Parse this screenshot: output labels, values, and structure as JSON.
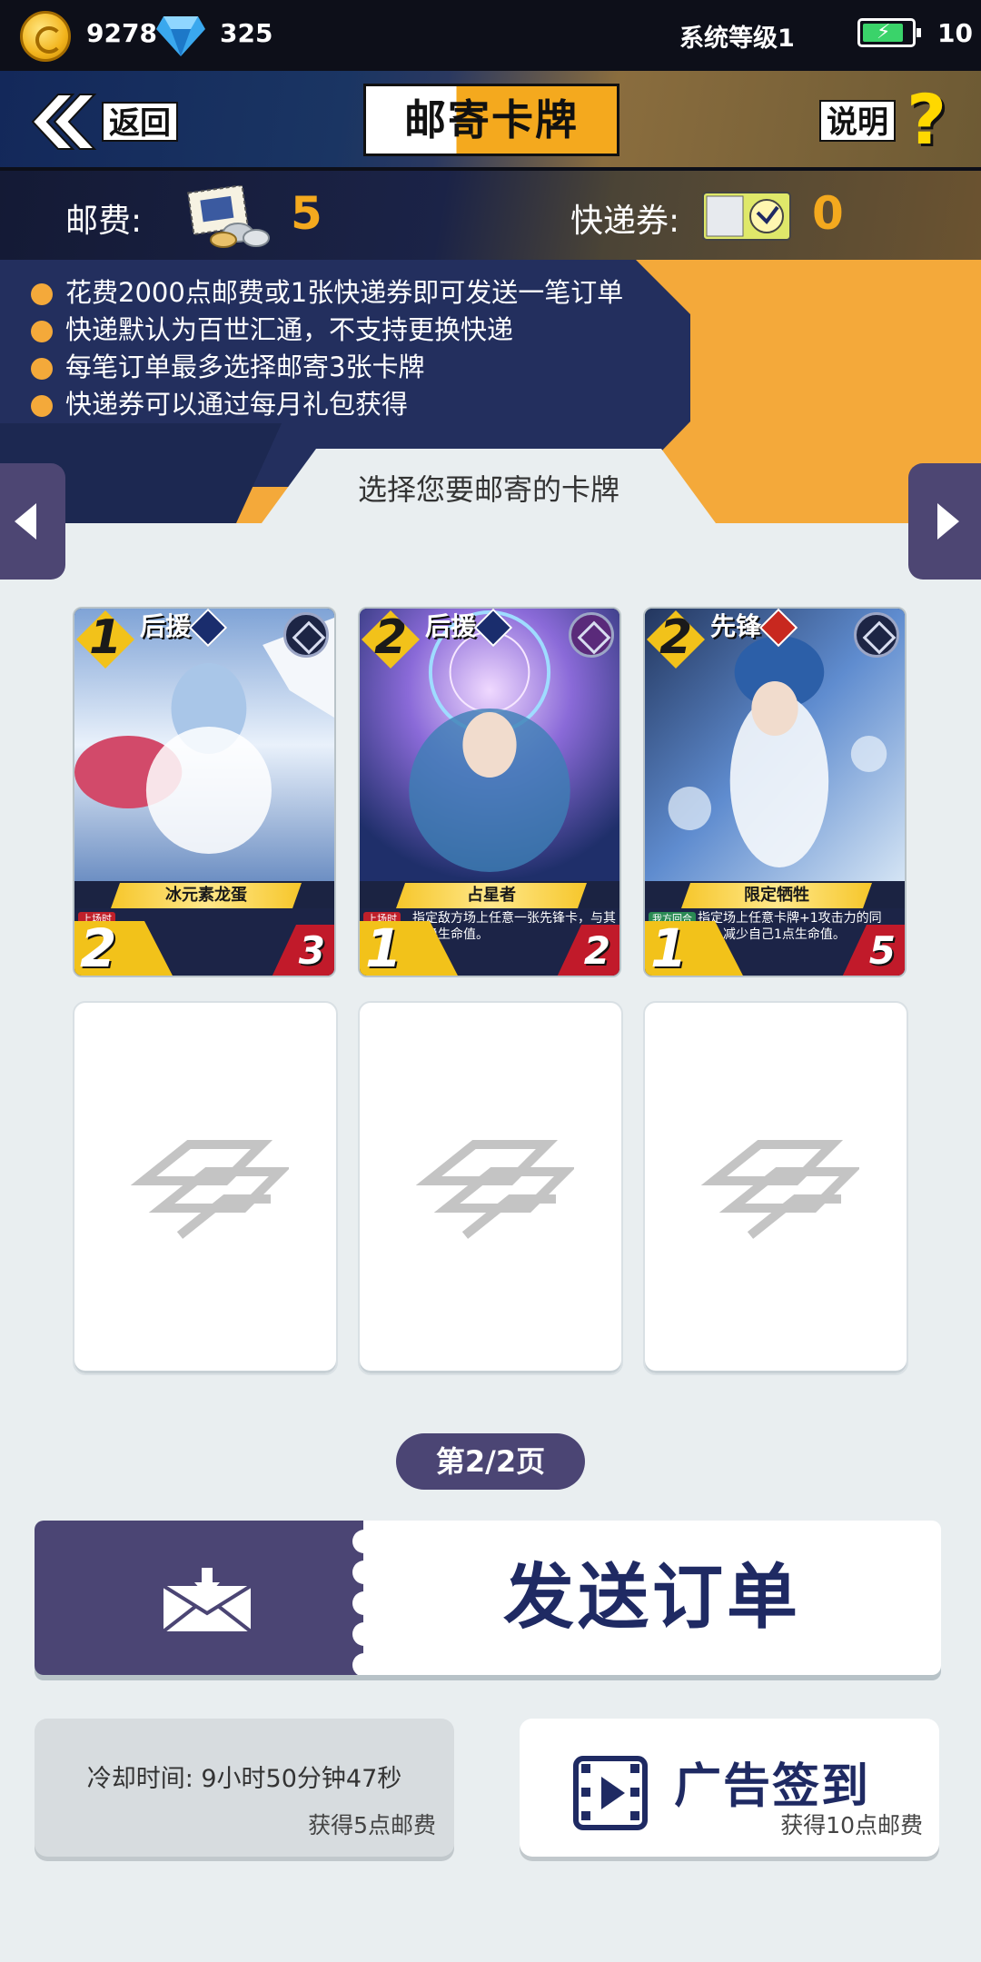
{
  "status_bar": {
    "coins": "9278",
    "gems": "325",
    "system_level": "系统等级1",
    "battery_value": "10",
    "battery_level": 0.85
  },
  "header": {
    "back_label": "返回",
    "title": "邮寄卡牌",
    "help_label": "说明",
    "help_symbol": "?"
  },
  "fees": {
    "postage_label": "邮费:",
    "postage_value": "5",
    "express_label": "快递券:",
    "express_value": "0"
  },
  "info_items": [
    "花费2000点邮费或1张快递券即可发送一笔订单",
    "快递默认为百世汇通，不支持更换快递",
    "每笔订单最多选择邮寄3张卡牌",
    "快递券可以通过每月礼包获得"
  ],
  "select_label": "选择您要邮寄的卡牌",
  "cards": [
    {
      "cost": "1",
      "role": "后援",
      "name": "冰元素龙蛋",
      "trigger": "上场时",
      "description": "",
      "attack": "2",
      "health": "3",
      "art_colors": [
        "#e9f1fb",
        "#a9c6e8",
        "#6d8fc3"
      ]
    },
    {
      "cost": "2",
      "role": "后援",
      "name": "占星者",
      "trigger": "上场时",
      "description": "指定敌方场上任意一张先锋卡，与其互换生命值。",
      "attack": "1",
      "health": "2",
      "art_colors": [
        "#c7b3ef",
        "#6b5ad1",
        "#2a4c8a"
      ]
    },
    {
      "cost": "2",
      "role": "先锋",
      "name": "限定牺牲",
      "trigger": "我方回合",
      "description": "指定场上任意卡牌+1攻击力的同时，减少自己1点生命值。",
      "attack": "1",
      "health": "5",
      "art_colors": [
        "#d4e4f4",
        "#4f7cc4",
        "#23365e"
      ]
    }
  ],
  "empty_slots": 3,
  "page_indicator": "第2/2页",
  "send_button": "发送订单",
  "cooldown": {
    "text": "冷却时间: 9小时50分钟47秒",
    "reward": "获得5点邮费"
  },
  "ad_signin": {
    "label": "广告签到",
    "reward": "获得10点邮费"
  },
  "colors": {
    "accent_orange": "#f4a91e",
    "purple": "#4b4574",
    "navy": "#1f2a63"
  }
}
